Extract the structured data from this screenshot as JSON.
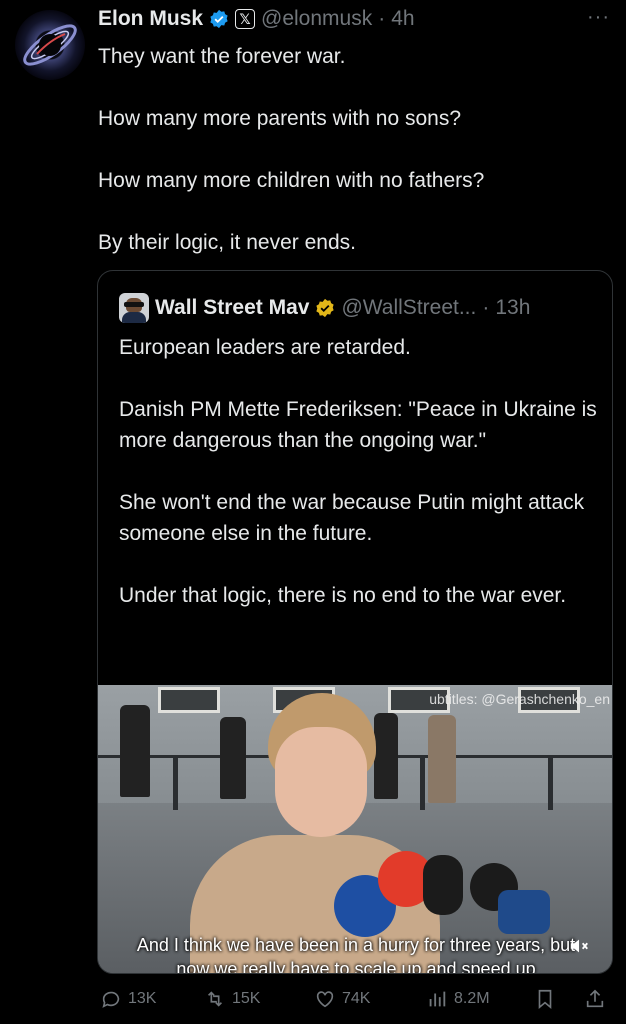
{
  "tweet": {
    "author": {
      "name": "Elon Musk",
      "handle": "@elonmusk",
      "separator": "·",
      "time": "4h",
      "verified_icon": "verified-badge-icon",
      "affiliation_icon": "x-logo-icon",
      "affiliation_label": "𝕏"
    },
    "more_label": "···",
    "paragraphs": [
      "They want the forever war.",
      "How many more parents with no sons?",
      "How many more children with no fathers?",
      "By their logic, it never ends."
    ]
  },
  "quote": {
    "author": {
      "name": "Wall Street Mav",
      "handle": "@WallStreet...",
      "separator": "·",
      "time": "13h",
      "verified_icon": "gold-verified-badge-icon"
    },
    "paragraphs": [
      "European leaders are retarded.",
      "Danish PM Mette Frederiksen:  \"Peace in Ukraine is more dangerous than the ongoing war.\"",
      "She won't end the war because Putin might attack someone else in the future.",
      "Under that logic, there is no end to the war ever."
    ],
    "video": {
      "watermark": "ubtitles: @Gerashchenko_en",
      "caption_line1": "And I think we have been in a hurry for three years, but",
      "caption_line2": "now we really have to scale up and speed up",
      "mute_icon": "speaker-muted-icon"
    }
  },
  "actions": {
    "replies": "13K",
    "reposts": "15K",
    "likes": "74K",
    "views": "8.2M",
    "bookmark_icon": "bookmark-icon",
    "share_icon": "share-icon"
  }
}
